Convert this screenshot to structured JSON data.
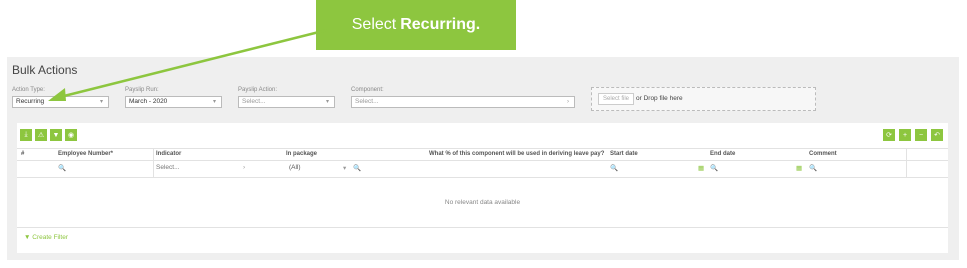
{
  "callout": {
    "prefix": "Select",
    "bold": "Recurring."
  },
  "page": {
    "title": "Bulk Actions"
  },
  "filters": {
    "action_type": {
      "label": "Action Type:",
      "value": "Recurring"
    },
    "payslip_run": {
      "label": "Payslip Run:",
      "value": "March - 2020"
    },
    "payslip_action": {
      "label": "Payslip Action:",
      "placeholder": "Select..."
    },
    "component": {
      "label": "Component:",
      "placeholder": "Select..."
    }
  },
  "upload": {
    "button": "Select file",
    "text": "or Drop file here"
  },
  "toolbar": {
    "left_icons": [
      "download-icon",
      "warning-icon",
      "filter-icon",
      "eye-icon"
    ],
    "right_icons": [
      "refresh-icon",
      "plus-icon",
      "minus-icon",
      "undo-icon"
    ]
  },
  "table": {
    "headers": [
      "#",
      "Employee Number*",
      "Indicator",
      "In package",
      "What % of this component will be used in deriving leave pay?",
      "Start date",
      "End date",
      "Comment"
    ],
    "filter_row": {
      "indicator": "Select...",
      "in_package": "(All)"
    },
    "empty_text": "No relevant data available",
    "create_filter": "Create Filter"
  },
  "colors": {
    "accent": "#8dc63f"
  }
}
